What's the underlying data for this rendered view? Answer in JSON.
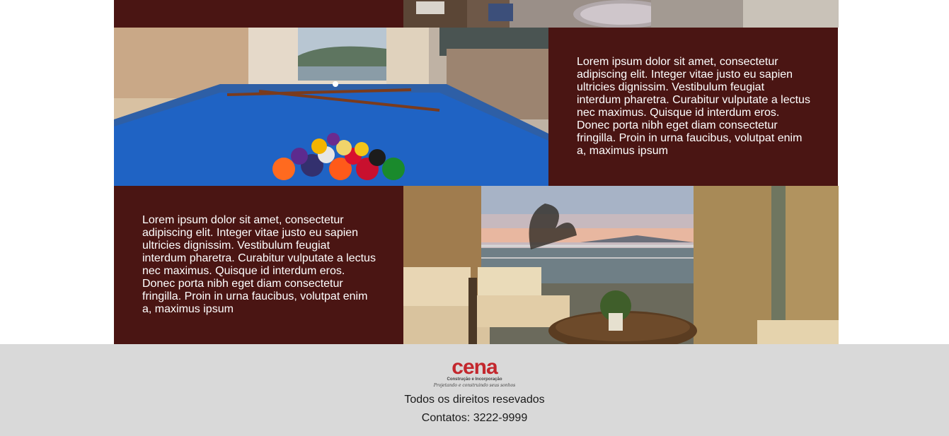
{
  "sections": [
    {
      "paragraph": "Lorem ipsum dolor sit amet, consectetur adipiscing elit. Integer vitae justo eu sapien ultricies dignissim. Vestibulum feugiat interdum pharetra. Curabitur vulputate a lectus nec maximus. Quisque id interdum eros. Donec porta nibh eget diam consectetur fringilla. Proin in urna faucibus, volutpat enim a, maximus ipsum"
    },
    {
      "paragraph": "Lorem ipsum dolor sit amet, consectetur adipiscing elit. Integer vitae justo eu sapien ultricies dignissim. Vestibulum feugiat interdum pharetra. Curabitur vulputate a lectus nec maximus. Quisque id interdum eros. Donec porta nibh eget diam consectetur fringilla. Proin in urna faucibus, volutpat enim a, maximus ipsum"
    }
  ],
  "footer": {
    "logo": {
      "word": "cena",
      "subtitle": "Construção e Incorporação",
      "tagline": "Projetando e construindo seus sonhos"
    },
    "rights": "Todos os direitos resevados",
    "contacts": "Contatos: 3222-9999"
  },
  "colors": {
    "panel": "#4a1513",
    "footer": "#d9d9d9",
    "brand": "#c3272d"
  },
  "images": [
    "living-room-photo",
    "pool-table-photo",
    "lounge-balcony-photo"
  ]
}
